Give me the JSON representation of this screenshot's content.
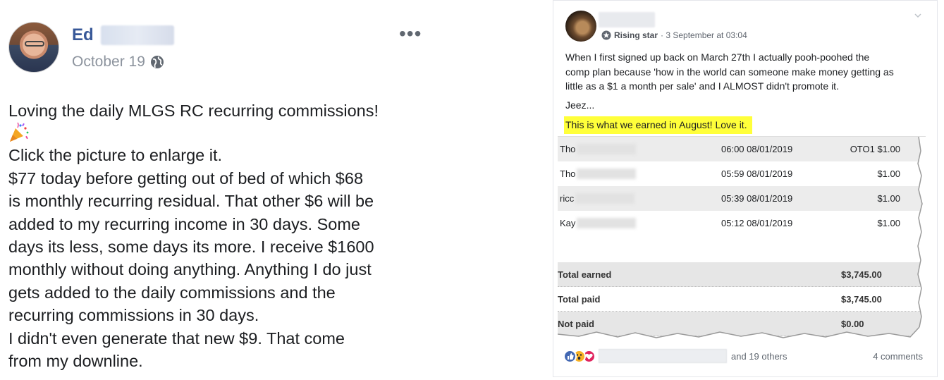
{
  "left_post": {
    "author_first_name": "Ed",
    "date": "October 19",
    "privacy_icon": "globe-icon",
    "more_options": "•••",
    "emoji_icon": "party-popper-icon",
    "lines": [
      "Loving the daily MLGS RC recurring commissions!",
      "Click the picture to enlarge it.",
      "$77 today before getting out of bed of which $68",
      "is monthly recurring residual. That other $6 will be",
      "added to my recurring income in 30 days. Some",
      "days its less, some days its more. I receive $1600",
      "monthly without doing anything. Anything I do just",
      "gets added to the daily commissions and the",
      "recurring commissions in 30 days.",
      "I didn't even generate that new $9. That come",
      "from my downline."
    ]
  },
  "right_post": {
    "badge": "Rising star",
    "meta": "· 3 September at 03:04",
    "text_lines": [
      "When I first signed up back on March 27th I actually pooh-poohed the",
      "comp plan because 'how in the world can someone make money getting as",
      "little as a $1 a month per sale' and I ALMOST didn't promote it."
    ],
    "text_2": "Jeez...",
    "highlight": "This is what we earned in August! Love it.",
    "table": {
      "rows": [
        {
          "name": "Tho",
          "time": "06:00 08/01/2019",
          "amount": "OTO1 $1.00"
        },
        {
          "name": "Tho",
          "time": "05:59 08/01/2019",
          "amount": "$1.00"
        },
        {
          "name": "ricc",
          "time": "05:39 08/01/2019",
          "amount": "$1.00"
        },
        {
          "name": "Kay",
          "time": "05:12 08/01/2019",
          "amount": "$1.00"
        }
      ],
      "summary": [
        {
          "label": "Total earned",
          "value": "$3,745.00"
        },
        {
          "label": "Total paid",
          "value": "$3,745.00"
        },
        {
          "label": "Not paid",
          "value": "$0.00"
        }
      ]
    },
    "footer": {
      "others": "and 19 others",
      "comments": "4 comments"
    },
    "colors": {
      "highlight": "#ffff3a",
      "link_blue": "#385898",
      "like": "#4267b2",
      "wow": "#f7b125",
      "love": "#e0245e"
    }
  }
}
